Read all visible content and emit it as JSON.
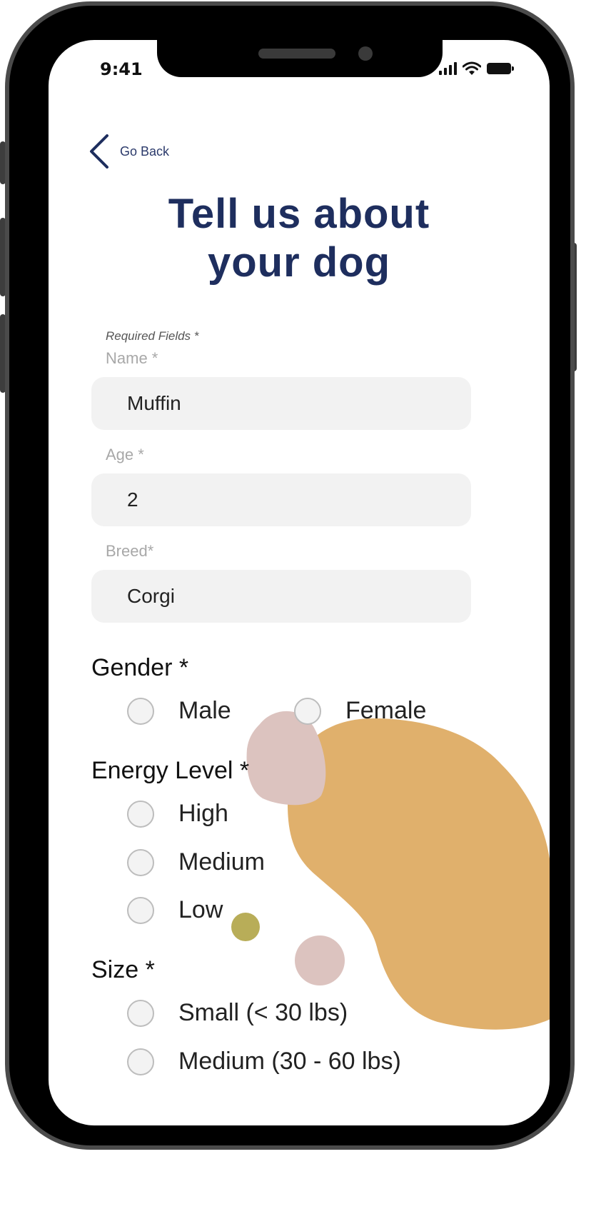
{
  "status_bar": {
    "time": "9:41"
  },
  "nav": {
    "back_label": "Go Back"
  },
  "page": {
    "title_line1": "Tell us about",
    "title_line2": "your dog",
    "required_note": "Required Fields *"
  },
  "fields": {
    "name": {
      "label": "Name *",
      "value": "Muffin"
    },
    "age": {
      "label": "Age *",
      "value": "2"
    },
    "breed": {
      "label": "Breed*",
      "value": "Corgi"
    }
  },
  "gender": {
    "title": "Gender *",
    "options": [
      "Male",
      "Female"
    ]
  },
  "energy": {
    "title": "Energy Level *",
    "options": [
      "High",
      "Medium",
      "Low"
    ]
  },
  "size": {
    "title": "Size *",
    "options": [
      "Small (< 30 lbs)",
      "Medium (30 - 60 lbs)"
    ]
  },
  "colors": {
    "title": "#1e2e5e",
    "field_bg": "#f2f2f2",
    "blob_orange": "#e0b06c",
    "blob_pink": "#dcc3bf",
    "blob_olive": "#b8ad58"
  }
}
